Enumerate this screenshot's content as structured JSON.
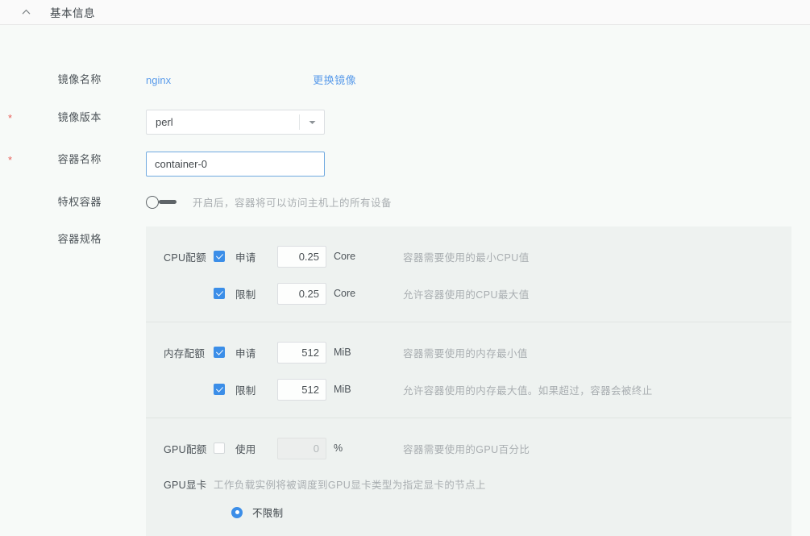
{
  "panel": {
    "title": "基本信息",
    "collapse_icon": "chevron-up-icon"
  },
  "form": {
    "image_name": {
      "label": "镜像名称",
      "value": "nginx",
      "change_link": "更换镜像"
    },
    "image_version": {
      "label": "镜像版本",
      "required_marker": "*",
      "value": "perl",
      "caret_icon": "chevron-down-icon"
    },
    "container_name": {
      "label": "容器名称",
      "required_marker": "*",
      "value": "container-0"
    },
    "privileged": {
      "label": "特权容器",
      "toggle_state": "off",
      "hint": "开启后，容器将可以访问主机上的所有设备"
    },
    "spec": {
      "label": "容器规格",
      "sections": [
        {
          "name": "CPU配额",
          "rows": [
            {
              "checked": true,
              "label": "申请",
              "value": "0.25",
              "unit": "Core",
              "hint": "容器需要使用的最小CPU值"
            },
            {
              "checked": true,
              "label": "限制",
              "value": "0.25",
              "unit": "Core",
              "hint": "允许容器使用的CPU最大值"
            }
          ]
        },
        {
          "name": "内存配额",
          "rows": [
            {
              "checked": true,
              "label": "申请",
              "value": "512",
              "unit": "MiB",
              "hint": "容器需要使用的内存最小值"
            },
            {
              "checked": true,
              "label": "限制",
              "value": "512",
              "unit": "MiB",
              "hint": "允许容器使用的内存最大值。如果超过，容器会被终止"
            }
          ]
        },
        {
          "name": "GPU配额",
          "rows": [
            {
              "checked": false,
              "label": "使用",
              "value": "0",
              "unit": "%",
              "hint": "容器需要使用的GPU百分比",
              "disabled": true
            }
          ],
          "gpu_card": {
            "name": "GPU显卡",
            "hint": "工作负载实例将被调度到GPU显卡类型为指定显卡的节点上",
            "radio_label": "不限制",
            "radio_selected": true
          }
        }
      ]
    }
  },
  "colors": {
    "accent_blue": "#3b8ee8",
    "link_blue": "#5a9bea",
    "required_red": "#e8615c",
    "panel_bg": "#eef2f0",
    "page_bg": "#f7faf8"
  }
}
